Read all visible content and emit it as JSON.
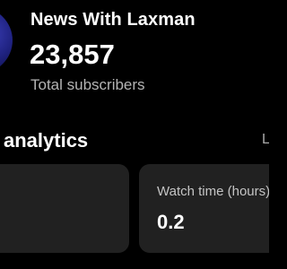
{
  "channel": {
    "name": "News With Laxman",
    "subscriber_count": "23,857",
    "subscriber_label": "Total subscribers"
  },
  "analytics": {
    "title": "analytics",
    "see_all_label": "L",
    "cards": [
      {
        "label": "",
        "value": ""
      },
      {
        "label": "Watch time (hours)",
        "value": "0.2"
      }
    ]
  },
  "colors": {
    "background": "#000000",
    "card_background": "#212121",
    "secondary_text": "#b4b4b4",
    "avatar_accent": "#2a2ea0"
  }
}
